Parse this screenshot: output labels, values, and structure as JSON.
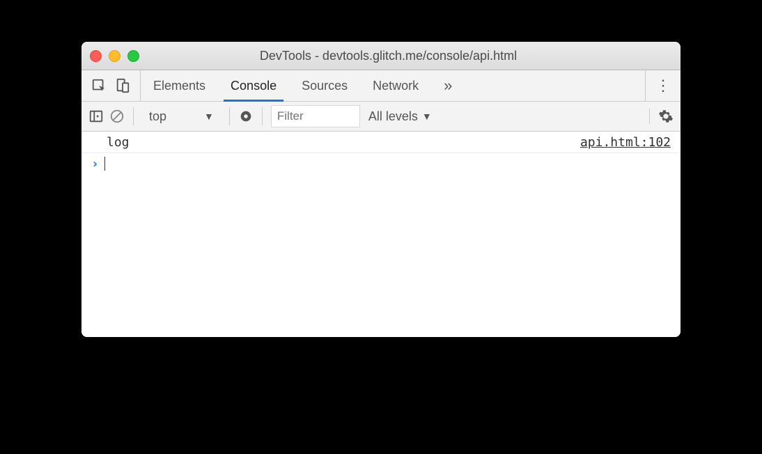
{
  "window": {
    "title": "DevTools - devtools.glitch.me/console/api.html"
  },
  "tabs": {
    "items": [
      "Elements",
      "Console",
      "Sources",
      "Network"
    ],
    "activeIndex": 1,
    "overflow": "»"
  },
  "toolbar": {
    "context": "top",
    "filterPlaceholder": "Filter",
    "levels": "All levels"
  },
  "console": {
    "rows": [
      {
        "message": "log",
        "source": "api.html:102"
      }
    ],
    "promptSymbol": "›"
  }
}
